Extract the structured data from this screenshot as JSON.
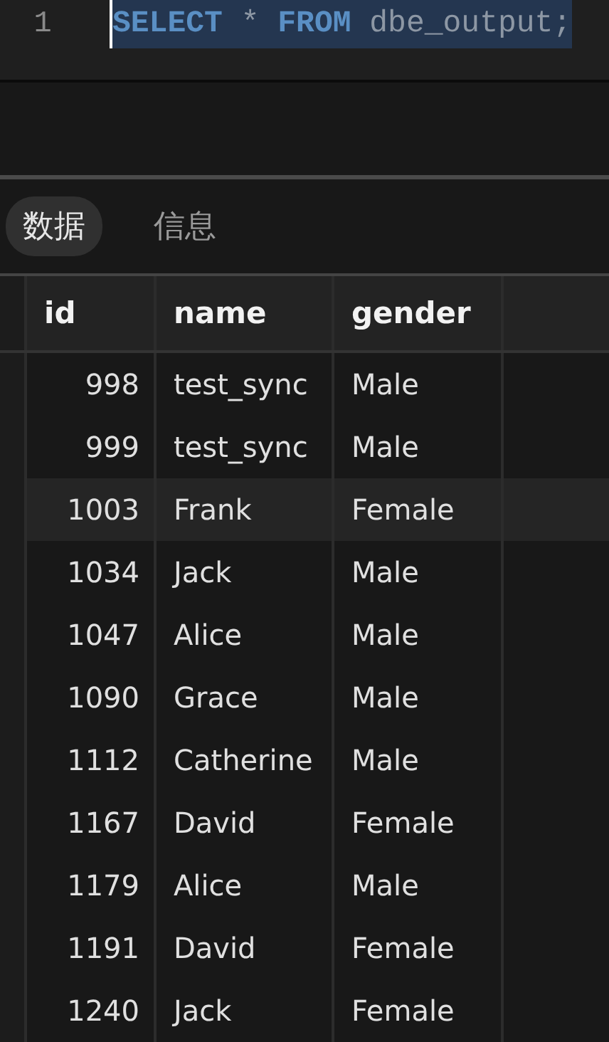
{
  "editor": {
    "lines": [
      {
        "number": "1",
        "selected": true,
        "tokens": [
          {
            "kind": "keyword",
            "text": "SELECT"
          },
          {
            "kind": "plain",
            "text": " * "
          },
          {
            "kind": "keyword",
            "text": "FROM"
          },
          {
            "kind": "plain",
            "text": " dbe_output;"
          }
        ]
      }
    ]
  },
  "tabs": [
    {
      "label": "数据",
      "selected": true
    },
    {
      "label": "信息",
      "selected": false
    }
  ],
  "table": {
    "columns": [
      "id",
      "name",
      "gender"
    ],
    "rows": [
      {
        "cells": [
          "998",
          "test_sync",
          "Male"
        ],
        "highlighted": false
      },
      {
        "cells": [
          "999",
          "test_sync",
          "Male"
        ],
        "highlighted": false
      },
      {
        "cells": [
          "1003",
          "Frank",
          "Female"
        ],
        "highlighted": true
      },
      {
        "cells": [
          "1034",
          "Jack",
          "Male"
        ],
        "highlighted": false
      },
      {
        "cells": [
          "1047",
          "Alice",
          "Male"
        ],
        "highlighted": false
      },
      {
        "cells": [
          "1090",
          "Grace",
          "Male"
        ],
        "highlighted": false
      },
      {
        "cells": [
          "1112",
          "Catherine",
          "Male"
        ],
        "highlighted": false
      },
      {
        "cells": [
          "1167",
          "David",
          "Female"
        ],
        "highlighted": false
      },
      {
        "cells": [
          "1179",
          "Alice",
          "Male"
        ],
        "highlighted": false
      },
      {
        "cells": [
          "1191",
          "David",
          "Female"
        ],
        "highlighted": false
      },
      {
        "cells": [
          "1240",
          "Jack",
          "Female"
        ],
        "highlighted": false
      }
    ]
  }
}
